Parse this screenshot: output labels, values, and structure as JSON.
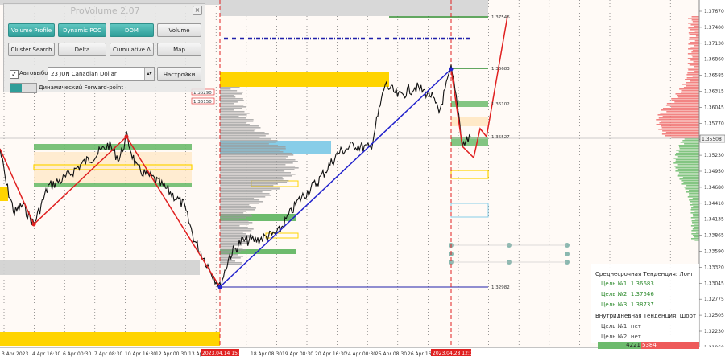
{
  "panel": {
    "title": "ProVolume 2.07",
    "close_icon": "×",
    "buttons": [
      {
        "label": "Volume Profile",
        "active": true
      },
      {
        "label": "Dynamic POC",
        "active": true
      },
      {
        "label": "DOM",
        "active": true
      },
      {
        "label": "Volume",
        "active": false
      },
      {
        "label": "Cluster Search",
        "active": false
      },
      {
        "label": "Delta",
        "active": false
      },
      {
        "label": "Cumulative Δ",
        "active": false
      },
      {
        "label": "Map",
        "active": false
      }
    ],
    "autoselect_checked": "✓",
    "autoselect_label": "Автовыбор",
    "instrument_value": "23 JUN Canadian Dollar",
    "settings_label": "Настройки",
    "forward_point_label": "Динамический Forward-point"
  },
  "price_axis": {
    "labels": [
      "1.37670",
      "1.37400",
      "1.37130",
      "1.36860",
      "1.36585",
      "1.36315",
      "1.36045",
      "1.35770",
      "1.35525",
      "1.35230",
      "1.34950",
      "1.34680",
      "1.34410",
      "1.34135",
      "1.33865",
      "1.33590",
      "1.33320",
      "1.33045",
      "1.32775",
      "1.32505",
      "1.32230",
      "1.31960"
    ],
    "current_price": "1.35508"
  },
  "time_axis": {
    "labels": [
      "3 Apr 2023",
      "4 Apr 16:30",
      "6 Apr 00:30",
      "7 Apr 08:30",
      "10 Apr 16:30",
      "12 Apr 00:30",
      "13 Apr 08:30",
      "18 Apr 08:30",
      "19 Apr 08:30",
      "20 Apr 16:30",
      "24 Apr 00:30",
      "25 Apr 08:30",
      "26 Apr 16:30"
    ],
    "highlight_left": "2023.04.14 15:30",
    "highlight_right": "2023.04.28 12:00"
  },
  "levels": [
    "1.37546",
    "1.36683",
    "1.36102",
    "1.35527",
    "1.32982"
  ],
  "small_labels": [
    "1.36290",
    "1.36150"
  ],
  "trend_box": {
    "medium_title": "Среднесрочная Тенденция: Лонг",
    "targets": [
      "Цель №1: 1.36683",
      "Цель №2: 1.37546",
      "Цель №3: 1.38737"
    ],
    "intraday_title": "Внутридневная Тенденция: Шорт",
    "intraday_targets": [
      "Цель №1: нет",
      "Цель №2: нет"
    ]
  },
  "balance": {
    "buy": "4221",
    "sell": "5384"
  },
  "colors": {
    "accent": "#2f9e99",
    "bear": "#cc0000",
    "trend_line": "#2222cc",
    "bull_zone": "#6dbb6d",
    "yellow_zone": "#ffd400",
    "target_green": "#2e8b2e"
  }
}
